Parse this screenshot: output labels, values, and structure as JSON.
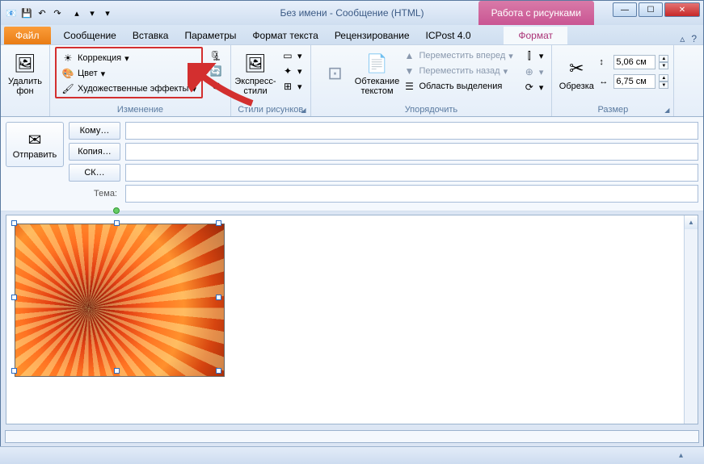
{
  "title": "Без имени  -  Сообщение (HTML)",
  "context_strip": "Работа с рисунками",
  "tabs": {
    "file": "Файл",
    "message": "Сообщение",
    "insert": "Вставка",
    "options": "Параметры",
    "format_text": "Формат текста",
    "review": "Рецензирование",
    "icpost": "ICPost 4.0",
    "format": "Формат"
  },
  "ribbon": {
    "remove_bg": {
      "label1": "Удалить",
      "label2": "фон"
    },
    "adjust_group_label": "Изменение",
    "correction": "Коррекция",
    "color": "Цвет",
    "artistic": "Художественные эффекты",
    "styles_group_label": "Стили рисунков",
    "express": "Экспресс-стили",
    "wrap_group_label": "",
    "wrap_label1": "Обтекание",
    "wrap_label2": "текстом",
    "arrange_group_label": "Упорядочить",
    "bring_forward": "Переместить вперед",
    "send_backward": "Переместить назад",
    "selection_pane": "Область выделения",
    "crop": "Обрезка",
    "size_group_label": "Размер",
    "height": "5,06 см",
    "width": "6,75 см"
  },
  "mail": {
    "send": "Отправить",
    "to": "Кому…",
    "cc": "Копия…",
    "bcc": "СК…",
    "subject_label": "Тема:"
  },
  "help_glyph": "?",
  "expand_glyph": "▴"
}
